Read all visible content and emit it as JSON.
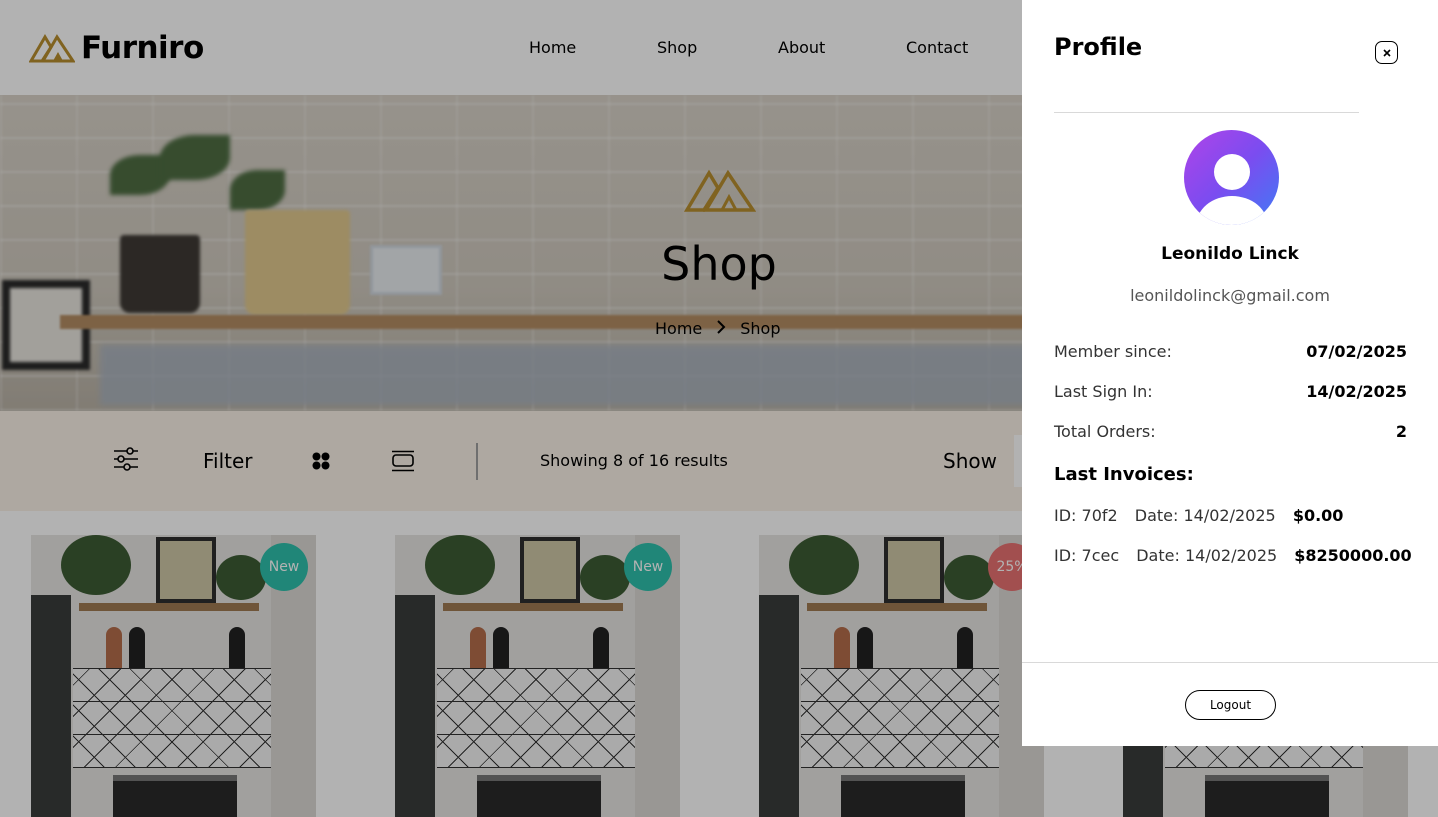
{
  "header": {
    "brand": "Furniro",
    "nav": [
      {
        "label": "Home"
      },
      {
        "label": "Shop"
      },
      {
        "label": "About"
      },
      {
        "label": "Contact"
      }
    ]
  },
  "hero": {
    "title": "Shop",
    "breadcrumb": {
      "home": "Home",
      "separator": "›",
      "current": "Shop"
    }
  },
  "filter_bar": {
    "filter_label": "Filter",
    "results_text": "Showing 8 of 16 results",
    "show_label": "Show"
  },
  "products": [
    {
      "badge": "New",
      "badge_type": "new"
    },
    {
      "badge": "New",
      "badge_type": "new"
    },
    {
      "badge": "25%",
      "badge_type": "sale"
    },
    {
      "badge": "",
      "badge_type": "none"
    }
  ],
  "colors": {
    "brand_gold": "#B88E2F",
    "badge_new": "#2EC1AC",
    "badge_sale": "#E97171",
    "filter_bg": "#F9F1E7"
  },
  "profile": {
    "title": "Profile",
    "close_icon": "close-icon",
    "name": "Leonildo Linck",
    "email": "leonildolinck@gmail.com",
    "stats": [
      {
        "label": "Member since:",
        "value": "07/02/2025"
      },
      {
        "label": "Last Sign In:",
        "value": "14/02/2025"
      },
      {
        "label": "Total Orders:",
        "value": "2"
      }
    ],
    "invoices_title": "Last Invoices:",
    "invoices": [
      {
        "id": "ID: 70f2",
        "date": "Date: 14/02/2025",
        "amount": "$0.00"
      },
      {
        "id": "ID: 7cec",
        "date": "Date: 14/02/2025",
        "amount": "$8250000.00"
      }
    ],
    "logout_label": "Logout"
  }
}
